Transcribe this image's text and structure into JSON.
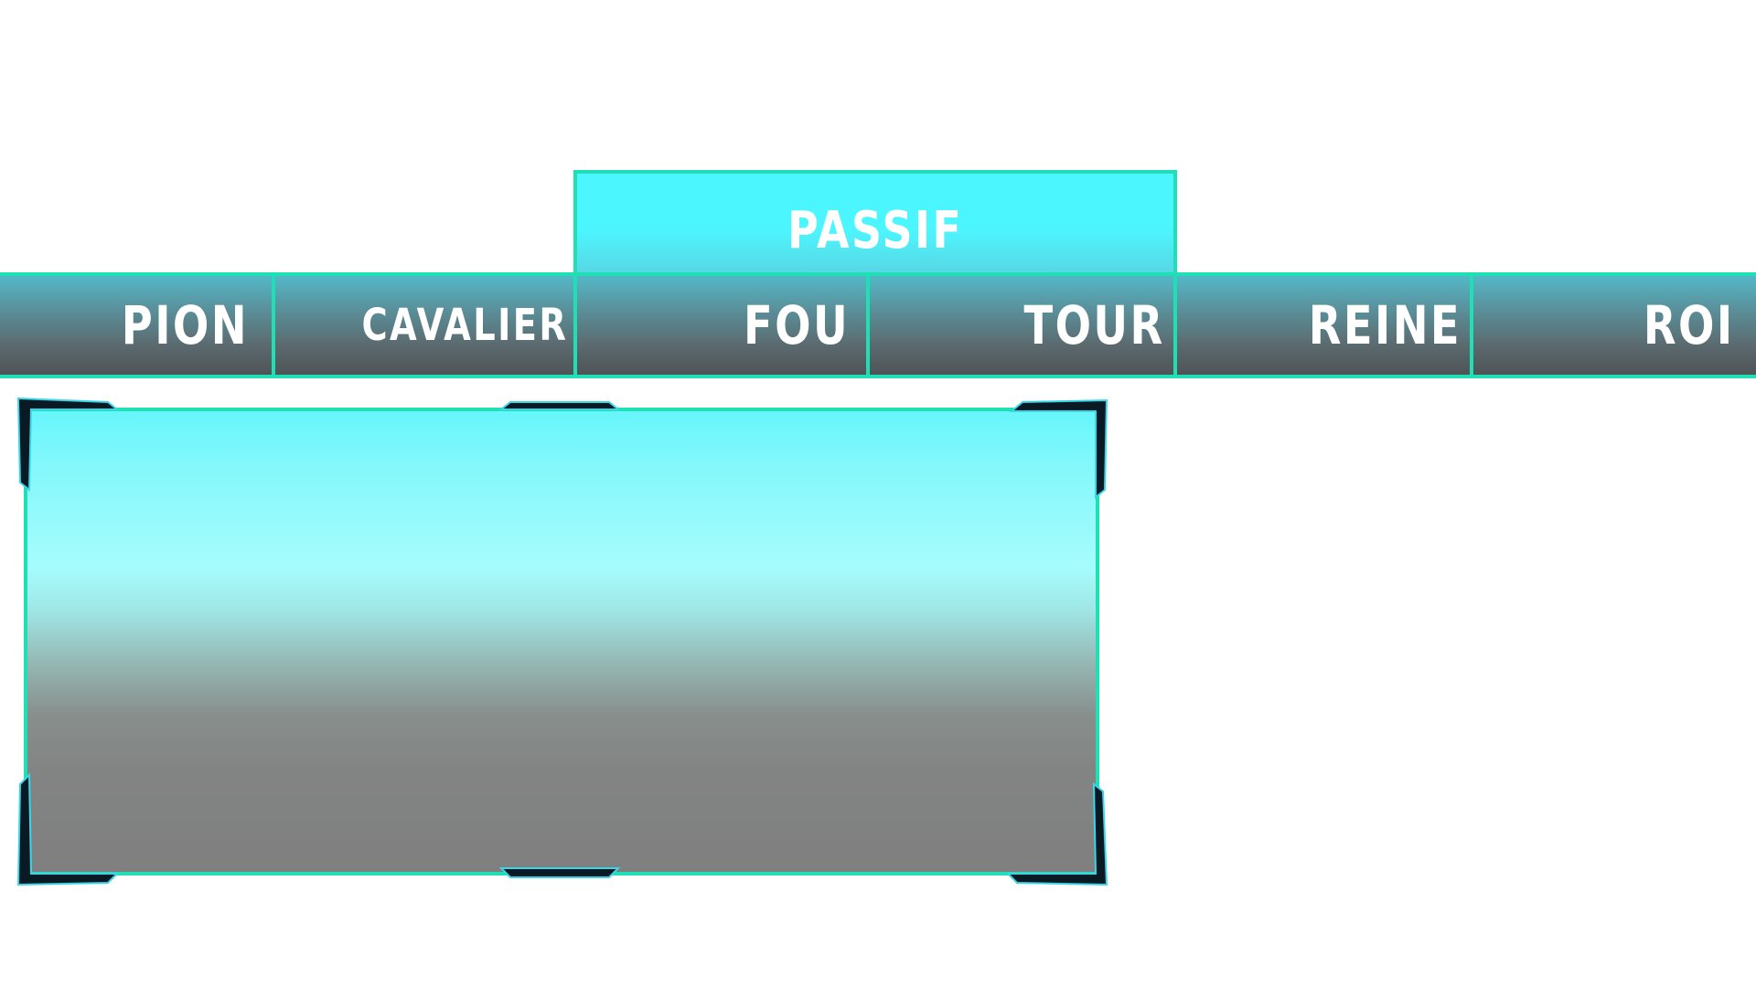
{
  "passif_tab": {
    "label": "PASSIF"
  },
  "piece_tabs": [
    {
      "label": "PION"
    },
    {
      "label": "CAVALIER"
    },
    {
      "label": "FOU"
    },
    {
      "label": "TOUR"
    },
    {
      "label": "REINE"
    },
    {
      "label": "ROI"
    }
  ],
  "colors": {
    "accent_border": "#1ee0b4",
    "passif_fill": "#4cf6ff",
    "bar_top": "#53b8c8",
    "bar_bottom": "#4e5456",
    "panel_top": "#66f6fb",
    "panel_bottom": "#7f7f7f",
    "corner_bracket": "#0a1a24"
  }
}
